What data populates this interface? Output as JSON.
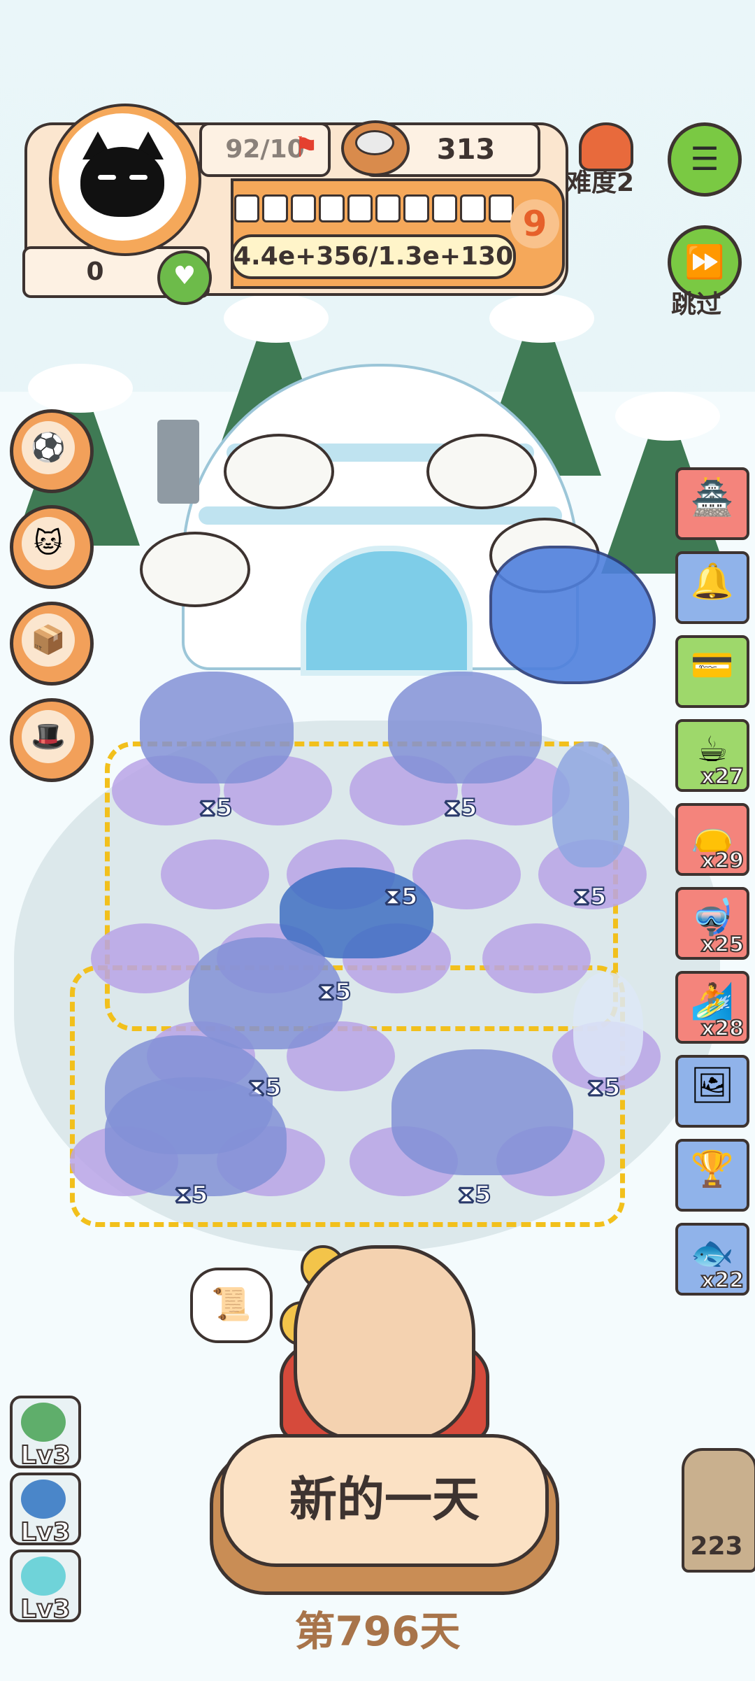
{
  "hud": {
    "rations": "92/10",
    "coins": "313",
    "hearts_count": "0",
    "progress_text": "4.4e+356/1.3e+130",
    "level": "9",
    "slots_filled": 0,
    "slots_total": 10,
    "difficulty_label": "难度2",
    "skip_label": "跳过"
  },
  "left_buttons": [
    {
      "icon": "ball-basket-icon",
      "glyph": "⚽"
    },
    {
      "icon": "lucky-cat-icon",
      "glyph": "🐱"
    },
    {
      "icon": "cardboard-box-icon",
      "glyph": "📦"
    },
    {
      "icon": "hat-icon",
      "glyph": "🎩"
    }
  ],
  "right_items": [
    {
      "icon": "temple-icon",
      "glyph": "🏯",
      "qty": "",
      "color": "red"
    },
    {
      "icon": "christmas-bell-icon",
      "glyph": "🔔",
      "qty": "",
      "color": "blue"
    },
    {
      "icon": "credit-card-icon",
      "glyph": "💳",
      "qty": "",
      "color": "green"
    },
    {
      "icon": "hot-tea-icon",
      "glyph": "☕",
      "qty": "x27",
      "color": "green"
    },
    {
      "icon": "red-pouch-icon",
      "glyph": "👝",
      "qty": "x29",
      "color": "red"
    },
    {
      "icon": "diving-mask-icon",
      "glyph": "🤿",
      "qty": "x25",
      "color": "red"
    },
    {
      "icon": "surfboard-icon",
      "glyph": "🏄",
      "qty": "x28",
      "color": "red"
    },
    {
      "icon": "picture-frame-icon",
      "glyph": "🖼",
      "qty": "",
      "color": "blue"
    },
    {
      "icon": "trophy-icon",
      "glyph": "🏆",
      "qty": "",
      "color": "blue"
    },
    {
      "icon": "flying-fish-icon",
      "glyph": "🐟",
      "qty": "x22",
      "color": "blue"
    }
  ],
  "animals": [
    {
      "kind": "mammoth",
      "timer": "5"
    },
    {
      "kind": "mammoth",
      "timer": "5"
    },
    {
      "kind": "squid",
      "timer": "5"
    },
    {
      "kind": "orca",
      "timer": "5"
    },
    {
      "kind": "mammoth",
      "timer": "5"
    },
    {
      "kind": "snowman",
      "timer": "5"
    },
    {
      "kind": "mammoth",
      "timer": "5"
    },
    {
      "kind": "mammoth",
      "timer": "5"
    },
    {
      "kind": "mammoth",
      "timer": "5"
    }
  ],
  "skills": [
    {
      "label": "Lv3",
      "color": "#5fae6b"
    },
    {
      "label": "Lv3",
      "color": "#4a86c9"
    },
    {
      "label": "Lv3",
      "color": "#6fd3d9"
    }
  ],
  "owl_count": "223",
  "main_button_label": "新的一天",
  "day_label": "第796天",
  "colors": {
    "accent_orange": "#f5a85a",
    "outline": "#3d3330",
    "green_button": "#7ac943",
    "tile_purple": "#b9a3e6",
    "dashed_yellow": "#f2c01c"
  }
}
